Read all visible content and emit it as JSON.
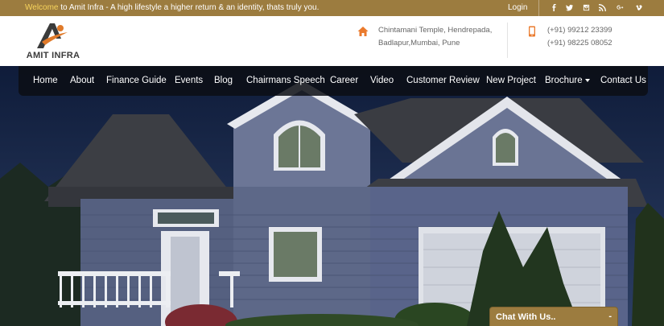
{
  "topbar": {
    "welcome_highlight": "Welcome",
    "welcome_rest": " to Amit Infra - A high lifestyle a higher return & an identity, thats truly you.",
    "login_label": "Login",
    "social_icons": [
      "facebook-icon",
      "twitter-icon",
      "instagram-icon",
      "rss-icon",
      "google-plus-icon",
      "vimeo-icon"
    ]
  },
  "logo": {
    "text": "AMIT INFRA"
  },
  "address": {
    "icon": "home-icon",
    "line1": "Chintamani Temple, Hendrepada,",
    "line2": "Badlapur,Mumbai, Pune"
  },
  "phone": {
    "icon": "mobile-phone-icon",
    "line1": "(+91) 99212 23399",
    "line2": "(+91) 98225 08052"
  },
  "nav": {
    "items": [
      "Home",
      "About",
      "Finance Guide",
      "Events",
      "Blog",
      "Chairmans Speech",
      "Career",
      "Video",
      "Customer Review",
      "New Project",
      "Brochure",
      "Contact Us"
    ]
  },
  "chat": {
    "label": "Chat With Us..",
    "minimize": "-"
  },
  "colors": {
    "brand_gold": "#9c7c3f",
    "highlight_yellow": "#f7d45c",
    "accent_orange": "#ea7a2c",
    "nav_bg": "#0c0e14"
  }
}
